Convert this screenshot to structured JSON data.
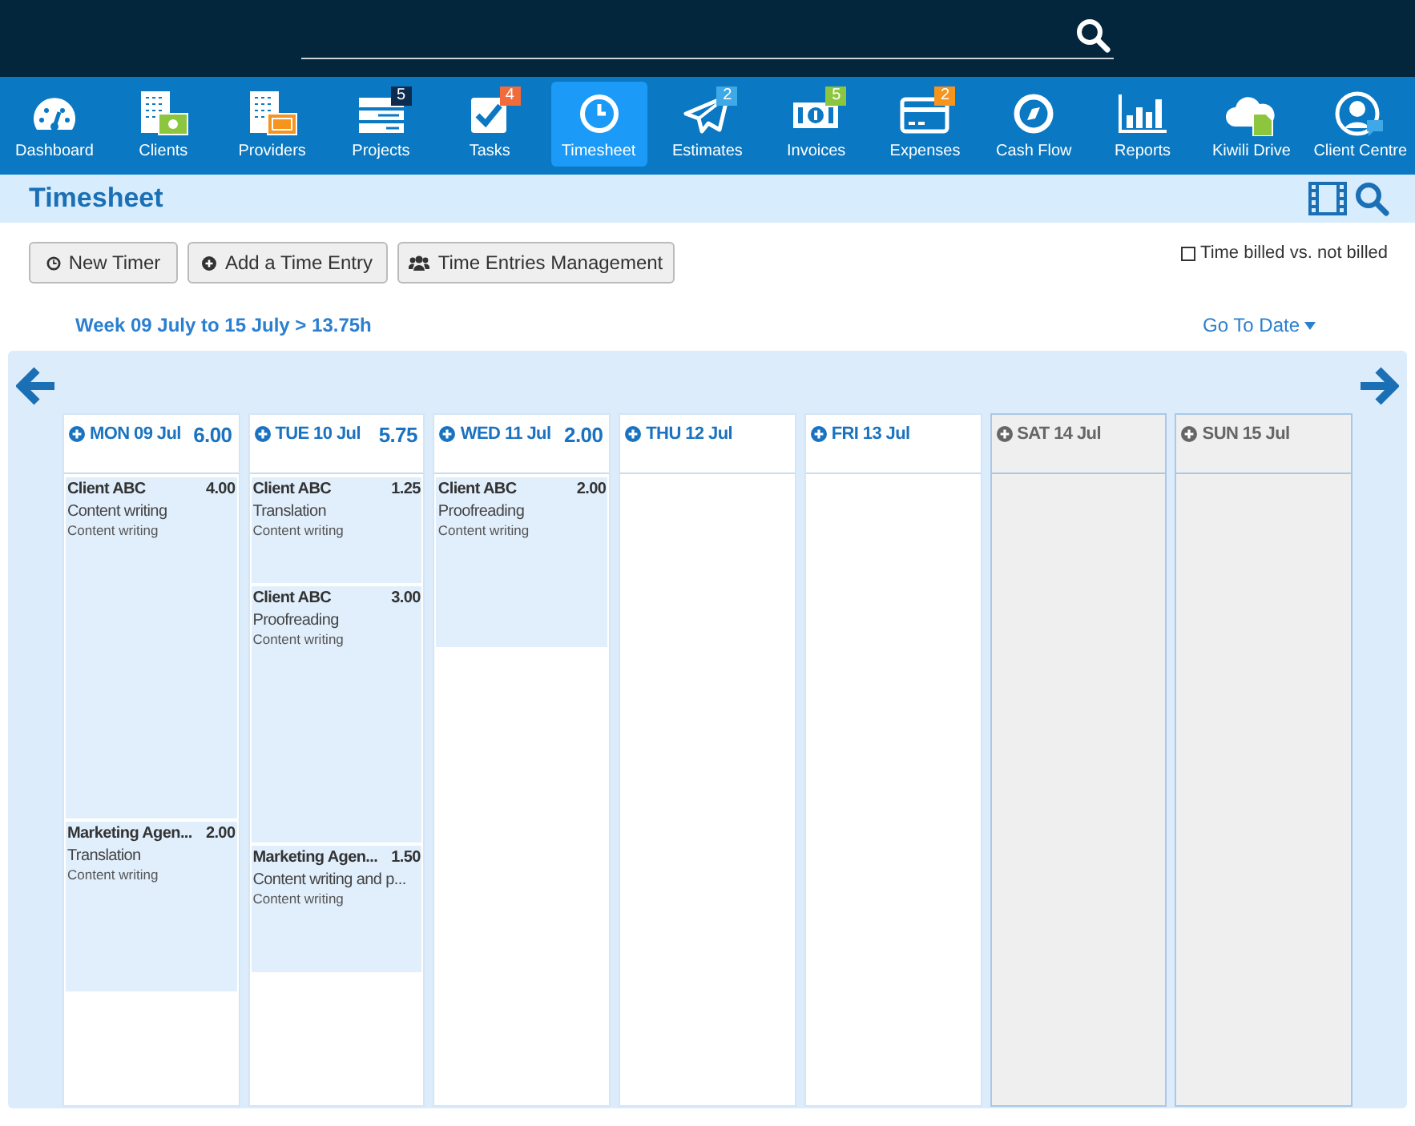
{
  "nav": [
    {
      "label": "Dashboard",
      "selected": false
    },
    {
      "label": "Clients",
      "selected": false
    },
    {
      "label": "Providers",
      "selected": false
    },
    {
      "label": "Projects",
      "selected": false,
      "badge": "5",
      "color": "#0b2b4f"
    },
    {
      "label": "Tasks",
      "selected": false,
      "badge": "4",
      "color": "#f26b3a"
    },
    {
      "label": "Timesheet",
      "selected": true
    },
    {
      "label": "Estimates",
      "selected": false,
      "badge": "2",
      "color": "#3fa9e8"
    },
    {
      "label": "Invoices",
      "selected": false,
      "badge": "5",
      "color": "#8cc63f"
    },
    {
      "label": "Expenses",
      "selected": false,
      "badge": "2",
      "color": "#f7941d"
    },
    {
      "label": "Cash Flow",
      "selected": false
    },
    {
      "label": "Reports",
      "selected": false
    },
    {
      "label": "Kiwili Drive",
      "selected": false
    },
    {
      "label": "Client Centre",
      "selected": false
    }
  ],
  "page_title": "Timesheet",
  "buttons": [
    "New Timer",
    "Add a Time Entry",
    "Time Entries Management"
  ],
  "billed_toggle": {
    "label": "Time billed vs. not billed",
    "checked": false
  },
  "week_summary": "Week 09 July to 15 July > 13.75h",
  "go_to_date": "Go To Date",
  "days": [
    {
      "label": "MON 09 Jul",
      "total": "6.00",
      "weekend": false,
      "entries": [
        {
          "client": "Client ABC",
          "hours": "4.00",
          "task": "Content writing",
          "category": "Content writing"
        },
        {
          "client": "Marketing Agen...",
          "hours": "2.00",
          "task": "Translation",
          "category": "Content writing"
        }
      ]
    },
    {
      "label": "TUE 10 Jul",
      "total": "5.75",
      "weekend": false,
      "entries": [
        {
          "client": "Client ABC",
          "hours": "1.25",
          "task": "Translation",
          "category": "Content writing"
        },
        {
          "client": "Client ABC",
          "hours": "3.00",
          "task": "Proofreading",
          "category": "Content writing"
        },
        {
          "client": "Marketing Agen...",
          "hours": "1.50",
          "task": "Content writing and p...",
          "category": "Content writing"
        }
      ]
    },
    {
      "label": "WED 11 Jul",
      "total": "2.00",
      "weekend": false,
      "entries": [
        {
          "client": "Client ABC",
          "hours": "2.00",
          "task": "Proofreading",
          "category": "Content writing"
        }
      ]
    },
    {
      "label": "THU 12 Jul",
      "weekend": false
    },
    {
      "label": "FRI 13 Jul",
      "weekend": false
    },
    {
      "label": "SAT 14 Jul",
      "weekend": true
    },
    {
      "label": "SUN 15 Jul",
      "weekend": true
    }
  ]
}
